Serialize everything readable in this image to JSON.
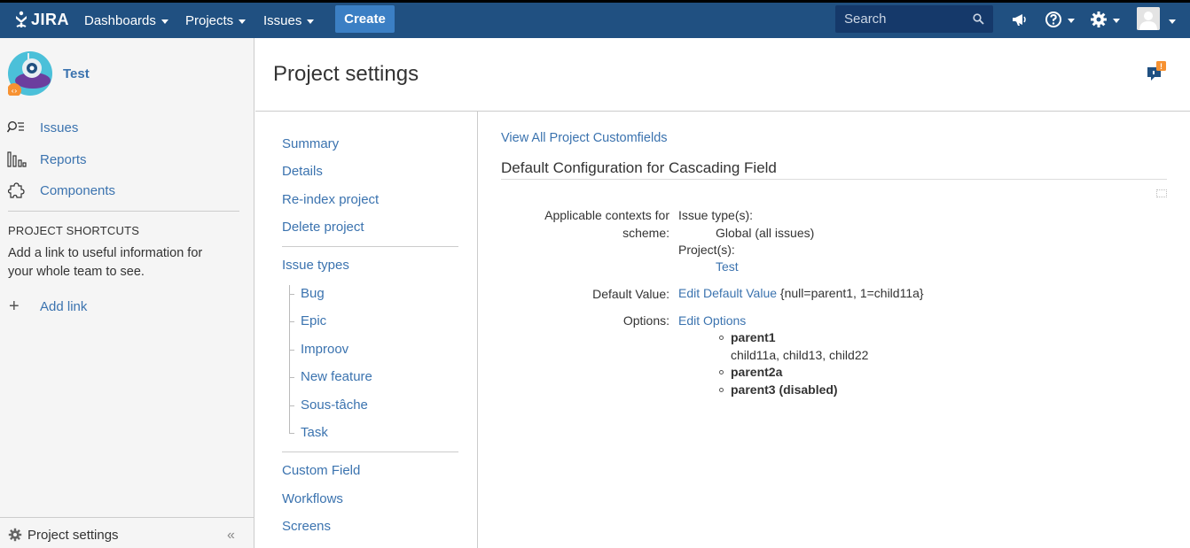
{
  "topbar": {
    "logo_text": "JIRA",
    "nav": [
      "Dashboards",
      "Projects",
      "Issues"
    ],
    "create_label": "Create",
    "search_placeholder": "Search",
    "icons": [
      "megaphone-icon",
      "help-icon",
      "gear-icon",
      "user-avatar"
    ],
    "bg_color": "#205081",
    "create_color": "#3b7fc4"
  },
  "sidebar": {
    "project_name": "Test",
    "links": [
      {
        "label": "Issues",
        "icon": "issues-search-icon"
      },
      {
        "label": "Reports",
        "icon": "reports-chart-icon"
      },
      {
        "label": "Components",
        "icon": "components-puzzle-icon"
      }
    ],
    "shortcuts_title": "PROJECT SHORTCUTS",
    "shortcuts_desc": "Add a link to useful information for your whole team to see.",
    "add_link": "Add link",
    "footer_label": "Project settings",
    "collapse_glyph": "«"
  },
  "header": {
    "title": "Project settings",
    "feedback_badge": "!"
  },
  "settings_nav": {
    "group1": [
      "Summary",
      "Details",
      "Re-index project",
      "Delete project"
    ],
    "issue_types_label": "Issue types",
    "issue_types": [
      "Bug",
      "Epic",
      "Improov",
      "New feature",
      "Sous-tâche",
      "Task"
    ],
    "group3": [
      "Custom Field",
      "Workflows",
      "Screens"
    ]
  },
  "main": {
    "view_all_link": "View All Project Customfields",
    "config_title": "Default Configuration for Cascading Field",
    "contexts_label_line1": "Applicable contexts for",
    "contexts_label_line2": "scheme:",
    "issue_types_heading": "Issue type(s):",
    "issue_types_value": "Global (all issues)",
    "projects_heading": "Project(s):",
    "projects_value": "Test",
    "default_value_label": "Default Value:",
    "edit_default_link": "Edit Default Value",
    "default_value_text": "{null=parent1, 1=child11a}",
    "options_label": "Options:",
    "edit_options_link": "Edit Options",
    "options": [
      {
        "name": "parent1",
        "children": "child11a, child13, child22"
      },
      {
        "name": "parent2a",
        "children": ""
      },
      {
        "name": "parent3 (disabled)",
        "children": ""
      }
    ]
  }
}
